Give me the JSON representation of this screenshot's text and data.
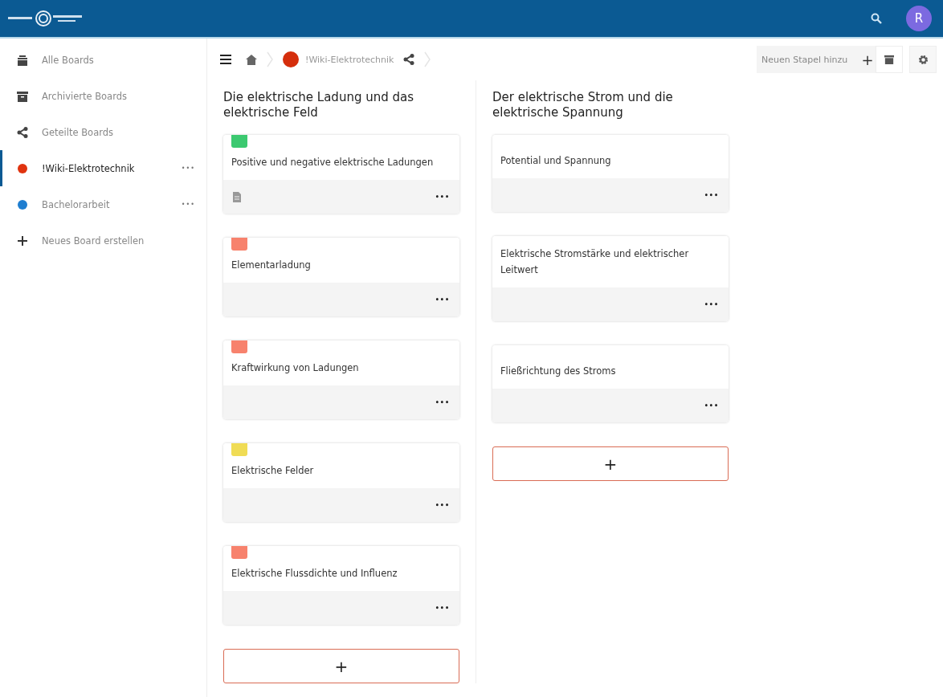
{
  "header": {
    "avatar": "R"
  },
  "sidebar": {
    "items": [
      {
        "kind": "all",
        "label": "Alle Boards",
        "selected": false
      },
      {
        "kind": "archive",
        "label": "Archivierte Boards",
        "selected": false
      },
      {
        "kind": "shared",
        "label": "Geteilte Boards",
        "selected": false
      },
      {
        "kind": "board",
        "label": "!Wiki-Elektrotechnik",
        "color": "#e0330f",
        "selected": true,
        "menu": "•••"
      },
      {
        "kind": "board",
        "label": "Bachelorarbeit",
        "color": "#1f7ed0",
        "selected": false,
        "menu": "•••"
      },
      {
        "kind": "new",
        "label": "Neues Board erstellen",
        "selected": false
      }
    ]
  },
  "toolbar": {
    "board_title": "!Wiki-Elektrotechnik",
    "color": "#d52e0c",
    "new_stack_placeholder": "Neuen Stapel hinzu",
    "add": "+"
  },
  "stacks": [
    {
      "title": "Die elektrische Ladung und das elektrische Feld",
      "add": "+",
      "cards": [
        {
          "title": "Positive und negative elektrische Ladungen",
          "color": "#3cc970",
          "has_description": true,
          "menu": "•••"
        },
        {
          "title": "Elementarladung",
          "color": "#f7826d",
          "has_description": false,
          "menu": "•••"
        },
        {
          "title": "Kraftwirkung von Ladungen",
          "color": "#f7826d",
          "has_description": false,
          "menu": "•••"
        },
        {
          "title": "Elektrische Felder",
          "color": "#f0dc55",
          "has_description": false,
          "menu": "•••"
        },
        {
          "title": "Elektrische Flussdichte und Influenz",
          "color": "#f7826d",
          "has_description": false,
          "menu": "•••"
        }
      ]
    },
    {
      "title": "Der elektrische Strom und die elektrische Spannung",
      "add": "+",
      "cards": [
        {
          "title": "Potential und Spannung",
          "has_description": false,
          "menu": "•••"
        },
        {
          "title": "Elektrische Stromstärke und elektrischer Leitwert",
          "has_description": false,
          "menu": "•••"
        },
        {
          "title": "Fließrichtung des Stroms",
          "has_description": false,
          "menu": "•••"
        }
      ]
    }
  ]
}
